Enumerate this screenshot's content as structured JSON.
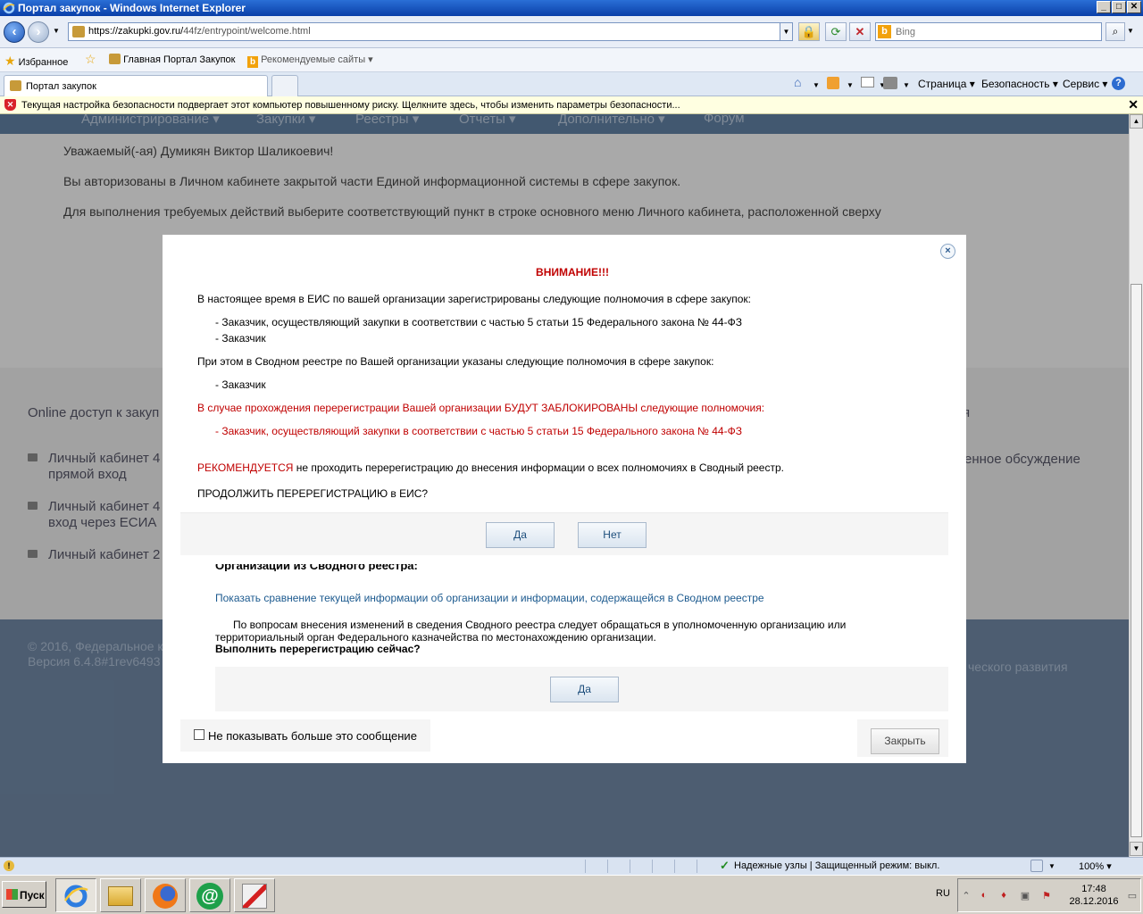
{
  "window": {
    "title": "Портал закупок - Windows Internet Explorer",
    "minimize": "_",
    "maximize": "□",
    "close": "✕"
  },
  "navbar": {
    "back": "‹",
    "forward": "›",
    "url_host": "https://zakupki.gov.ru/",
    "url_path": "44fz/entrypoint/welcome.html",
    "lock": "🔒",
    "refresh": "⟳",
    "stop": "✕",
    "search_placeholder": "Bing",
    "search_logo": "b",
    "search_go": "⌕"
  },
  "favbar": {
    "favorites": "Избранное",
    "link1": "Главная Портал Закупок",
    "link2": "Рекомендуемые сайты ▾"
  },
  "tabs": {
    "active": "Портал закупок"
  },
  "commands": {
    "page": "Страница ▾",
    "safety": "Безопасность ▾",
    "tools": "Сервис ▾",
    "help": "?"
  },
  "infobar": {
    "text": "Текущая настройка безопасности подвергает этот компьютер повышенному риску. Щелкните здесь, чтобы изменить параметры безопасности...",
    "close": "✕"
  },
  "page": {
    "menu": [
      "Администрирование ▾",
      "Закупки ▾",
      "Реестры ▾",
      "Отчеты ▾",
      "Дополнительно ▾",
      "Форум"
    ],
    "greeting": "Уважаемый(-ая) Думикян Виктор Шаликоевич!",
    "auth_text": "Вы авторизованы в Личном кабинете закрытой части Единой информационной системы в сфере закупок.",
    "instruction": "Для выполнения требуемых действий выберите соответствующий пункт в строке основного меню Личного кабинета, расположенной сверху",
    "online_header": "Online доступ к закуп",
    "right_header": "я",
    "links": [
      "Личный кабинет 4",
      "прямой вход",
      "Личный кабинет 4",
      "вход через ЕСИА",
      "Личный кабинет 2"
    ],
    "right_text": "енное обсуждение",
    "footer_copyright": "© 2016, Федеральное к",
    "footer_version": "Версия 6.4.8#1rev6493",
    "footer_right": "ческого развития"
  },
  "modal": {
    "close_x": "×",
    "title": "ВНИМАНИЕ!!!",
    "line1": "В настоящее время в ЕИС по вашей организации зарегистрированы следующие полномочия в сфере закупок:",
    "item1": "- Заказчик, осуществляющий закупки в соответствии с частью 5 статьи 15 Федерального закона № 44-ФЗ",
    "item2": "- Заказчик",
    "line2": "При этом в Сводном реестре по Вашей организации указаны следующие полномочия в сфере закупок:",
    "item3": "- Заказчик",
    "warning": "В случае прохождения перерегистрации Вашей организации БУДУТ ЗАБЛОКИРОВАНЫ следующие полномочия:",
    "blocked_item": "- Заказчик, осуществляющий закупки в соответствии с частью 5 статьи 15 Федерального закона № 44-ФЗ",
    "recommend_word": "РЕКОМЕНДУЕТСЯ",
    "recommend_rest": " не проходить перерегистрацию до внесения информации о всех полномочиях в Сводный реестр.",
    "continue_question": "ПРОДОЛЖИТЬ ПЕРЕРЕГИСТРАЦИЮ в ЕИС?",
    "yes": "Да",
    "no": "Нет",
    "under_text": "Организации из Сводного реестра:",
    "compare_link": "Показать сравнение текущей информации об организации и информации, содержащейся в Сводном реестре",
    "info_paragraph": "По вопросам внесения изменений в сведения Сводного реестра следует обращаться в уполномоченную организацию или территориальный орган Федерального казначейства по местонахождению организации.",
    "rereg_question": "Выполнить перерегистрацию сейчас?",
    "yes2": "Да",
    "dont_show": "Не показывать больше это сообщение",
    "close_button": "Закрыть"
  },
  "statusbar": {
    "zone": "Надежные узлы | Защищенный режим: выкл.",
    "zoom": "100%  ▾"
  },
  "taskbar": {
    "start": "Пуск",
    "lang": "RU",
    "time": "17:48",
    "date": "28.12.2016"
  }
}
